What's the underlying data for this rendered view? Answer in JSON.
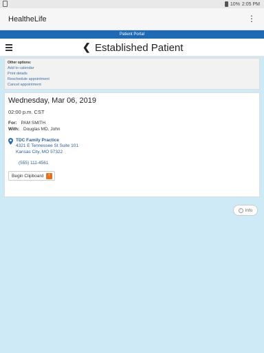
{
  "status": {
    "battery": "10%",
    "time": "2:05 PM"
  },
  "app": {
    "title": "HealtheLife"
  },
  "portal": {
    "label": "Patient Portal"
  },
  "header": {
    "title": "Established Patient"
  },
  "options": {
    "label": "Other options:",
    "items": [
      "Add to calendar",
      "Print details",
      "Reschedule appointment",
      "Cancel appointment"
    ]
  },
  "appointment": {
    "date": "Wednesday, Mar 06, 2019",
    "time": "02:00 p.m. CST",
    "for_label": "For:",
    "for_value": "PAM SMITH",
    "with_label": "With:",
    "with_value": "Douglas MD, John",
    "location_name": "TDC Family Practice",
    "address1": "4321 E Tennessee St Suite 101",
    "address2": "Kansas City, MO 57322",
    "phone": "(555) 111-4561",
    "clipboard_label": "Begin Clipboard",
    "clipboard_alert": "!"
  },
  "info": {
    "label": "Info",
    "icon": "i"
  }
}
